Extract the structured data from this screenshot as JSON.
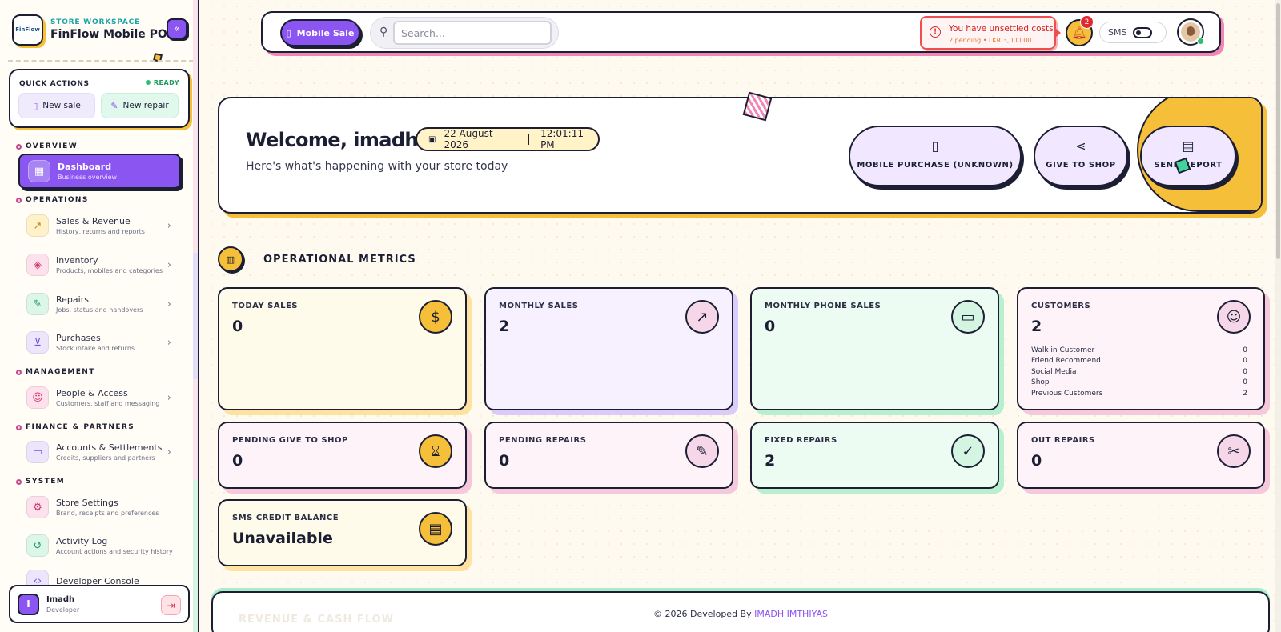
{
  "brand": {
    "subtitle": "STORE WORKSPACE",
    "name": "FinFlow Mobile POS",
    "logo_text": "FinFlow"
  },
  "quick_actions": {
    "title": "QUICK ACTIONS",
    "status": "READY",
    "new_sale": "New sale",
    "new_repair": "New repair"
  },
  "sections": {
    "overview": "OVERVIEW",
    "operations": "OPERATIONS",
    "management": "MANAGEMENT",
    "finance": "FINANCE & PARTNERS",
    "system": "SYSTEM"
  },
  "nav": {
    "dashboard": {
      "title": "Dashboard",
      "sub": "Business overview",
      "icon": "grid-icon"
    },
    "sales": {
      "title": "Sales & Revenue",
      "sub": "History, returns and reports",
      "icon": "trend-icon"
    },
    "inventory": {
      "title": "Inventory",
      "sub": "Products, mobiles and categories",
      "icon": "box-icon"
    },
    "repairs": {
      "title": "Repairs",
      "sub": "Jobs, status and handovers",
      "icon": "wrench-icon"
    },
    "purchases": {
      "title": "Purchases",
      "sub": "Stock intake and returns",
      "icon": "cart-icon"
    },
    "people": {
      "title": "People & Access",
      "sub": "Customers, staff and messaging",
      "icon": "users-icon"
    },
    "accounts": {
      "title": "Accounts & Settlements",
      "sub": "Credits, suppliers and partners",
      "icon": "card-icon"
    },
    "settings": {
      "title": "Store Settings",
      "sub": "Brand, receipts and preferences",
      "icon": "gear-icon"
    },
    "activity": {
      "title": "Activity Log",
      "sub": "Account actions and security history",
      "icon": "history-icon"
    },
    "devconsole": {
      "title": "Developer Console",
      "sub": "",
      "icon": "code-icon"
    }
  },
  "user": {
    "initial": "I",
    "name": "Imadh",
    "role": "Developer"
  },
  "header": {
    "mobile_sale": "Mobile Sale",
    "search_placeholder": "Search...",
    "alert_title": "You have unsettled costs",
    "alert_sub": "2 pending • LKR 3,000.00",
    "notification_count": "2",
    "sms_label": "SMS"
  },
  "welcome": {
    "title": "Welcome, imadh!",
    "subtitle": "Here's what's happening with your store today",
    "date": "22 August 2026",
    "time": "12:01:11 PM"
  },
  "actions": {
    "mobile_purchase": "MOBILE PURCHASE (UNKNOWN)",
    "give_to_shop": "GIVE TO SHOP",
    "send_report": "SEND REPORT"
  },
  "metrics": {
    "title": "OPERATIONAL METRICS",
    "today_sales": {
      "label": "TODAY SALES",
      "value": "0"
    },
    "monthly_sales": {
      "label": "MONTHLY SALES",
      "value": "2"
    },
    "monthly_phone_sales": {
      "label": "MONTHLY PHONE SALES",
      "value": "0"
    },
    "customers": {
      "label": "CUSTOMERS",
      "value": "2",
      "breakdown": [
        {
          "label": "Walk in Customer",
          "value": "0"
        },
        {
          "label": "Friend Recommend",
          "value": "0"
        },
        {
          "label": "Social Media",
          "value": "0"
        },
        {
          "label": "Shop",
          "value": "0"
        },
        {
          "label": "Previous Customers",
          "value": "2"
        }
      ]
    },
    "pending_give_to_shop": {
      "label": "PENDING GIVE TO SHOP",
      "value": "0"
    },
    "pending_repairs": {
      "label": "PENDING REPAIRS",
      "value": "0"
    },
    "fixed_repairs": {
      "label": "FIXED REPAIRS",
      "value": "2"
    },
    "out_repairs": {
      "label": "OUT REPAIRS",
      "value": "0"
    },
    "sms_credit": {
      "label": "SMS CREDIT BALANCE",
      "value": "Unavailable"
    }
  },
  "footer": {
    "next_section": "REVENUE & CASH FLOW",
    "copyright": "© 2026 Developed By",
    "developer": "IMADH IMTHIYAS"
  }
}
